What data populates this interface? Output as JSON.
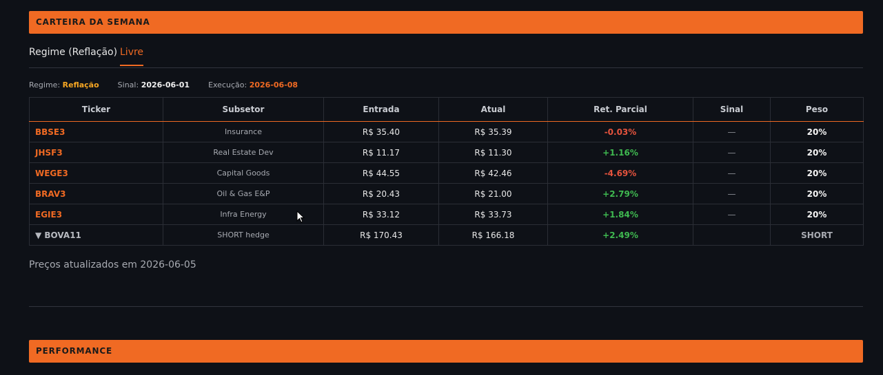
{
  "sections": {
    "carteira_title": "CARTEIRA DA SEMANA",
    "performance_title": "PERFORMANCE"
  },
  "tabs": [
    {
      "label": "Regime (Reflação)",
      "active": false
    },
    {
      "label": "Livre",
      "active": true
    }
  ],
  "meta": {
    "regime_label": "Regime:",
    "regime_value": "Reflação",
    "sinal_label": "Sinal:",
    "sinal_value": "2026-06-01",
    "execucao_label": "Execução:",
    "execucao_value": "2026-06-08"
  },
  "table": {
    "headers": [
      "Ticker",
      "Subsetor",
      "Entrada",
      "Atual",
      "Ret. Parcial",
      "Sinal",
      "Peso"
    ],
    "rows": [
      {
        "ticker": "BBSE3",
        "subsetor": "Insurance",
        "entrada": "R$ 35.40",
        "atual": "R$ 35.39",
        "ret": "-0.03%",
        "sinal": "—",
        "peso": "20%"
      },
      {
        "ticker": "JHSF3",
        "subsetor": "Real Estate Dev",
        "entrada": "R$ 11.17",
        "atual": "R$ 11.30",
        "ret": "+1.16%",
        "sinal": "—",
        "peso": "20%"
      },
      {
        "ticker": "WEGE3",
        "subsetor": "Capital Goods",
        "entrada": "R$ 44.55",
        "atual": "R$ 42.46",
        "ret": "-4.69%",
        "sinal": "—",
        "peso": "20%"
      },
      {
        "ticker": "BRAV3",
        "subsetor": "Oil & Gas E&P",
        "entrada": "R$ 20.43",
        "atual": "R$ 21.00",
        "ret": "+2.79%",
        "sinal": "—",
        "peso": "20%"
      },
      {
        "ticker": "EGIE3",
        "subsetor": "Infra Energy",
        "entrada": "R$ 33.12",
        "atual": "R$ 33.73",
        "ret": "+1.84%",
        "sinal": "—",
        "peso": "20%"
      },
      {
        "ticker": "▼ BOVA11",
        "subsetor": "SHORT hedge",
        "entrada": "R$ 170.43",
        "atual": "R$ 166.18",
        "ret": "+2.49%",
        "sinal": "",
        "peso": "SHORT"
      }
    ]
  },
  "footer": {
    "updated_text": "Preços atualizados em 2026-06-05"
  },
  "colors": {
    "accent": "#f06a23",
    "positive": "#3fb950",
    "negative": "#e5533d",
    "background": "#0e1117"
  }
}
